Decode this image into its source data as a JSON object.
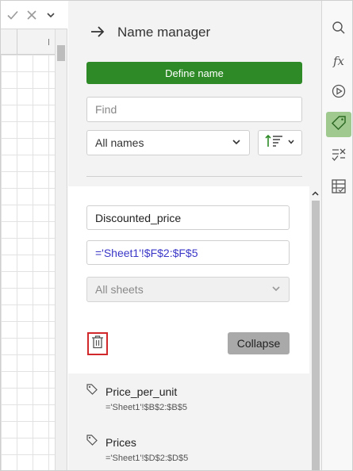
{
  "formula_bar": {
    "confirm_icon": "check-icon",
    "cancel_icon": "x-icon",
    "expand_icon": "chevron-down-icon"
  },
  "panel": {
    "title": "Name manager",
    "back_icon": "arrow-right-icon",
    "define_button": "Define name",
    "find_placeholder": "Find",
    "filter_value": "All names",
    "sort_icon": "sort-icon"
  },
  "editor": {
    "name_value": "Discounted_price",
    "reference_value": "='Sheet1'!$F$2:$F$5",
    "scope_value": "All sheets",
    "delete_icon": "trash-icon",
    "collapse_button": "Collapse"
  },
  "names": [
    {
      "name": "Price_per_unit",
      "reference": "='Sheet1'!$B$2:$B$5",
      "icon": "tag-icon"
    },
    {
      "name": "Prices",
      "reference": "='Sheet1'!$D$2:$D$5",
      "icon": "tag-icon"
    }
  ],
  "toolstrip": [
    {
      "icon": "search-icon",
      "active": false
    },
    {
      "icon": "function-icon",
      "active": false
    },
    {
      "icon": "play-icon",
      "active": false
    },
    {
      "icon": "tag-icon",
      "active": true
    },
    {
      "icon": "checklist-icon",
      "active": false
    },
    {
      "icon": "table-icon",
      "active": false
    }
  ],
  "colors": {
    "accent_green": "#2d8a27",
    "active_tool": "#9fc98f",
    "reference_text": "#3a37c7",
    "delete_outline": "#d0282b"
  }
}
